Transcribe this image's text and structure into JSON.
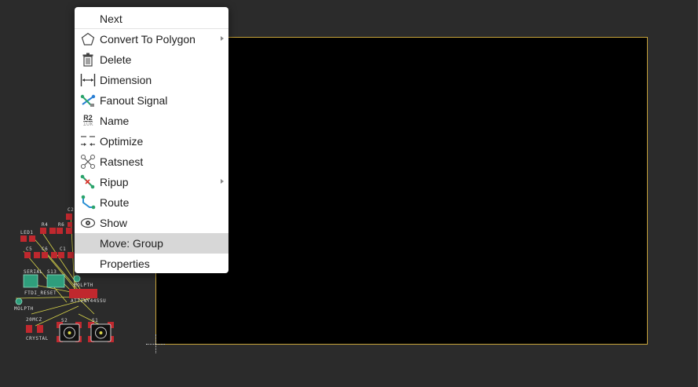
{
  "menu": {
    "items": [
      {
        "label": "Next",
        "icon": "none",
        "submenu": false
      },
      {
        "label": "Convert To Polygon",
        "icon": "polygon-icon",
        "submenu": true
      },
      {
        "label": "Delete",
        "icon": "trash-icon",
        "submenu": false
      },
      {
        "label": "Dimension",
        "icon": "dimension-icon",
        "submenu": false
      },
      {
        "label": "Fanout Signal",
        "icon": "fanout-icon",
        "submenu": false
      },
      {
        "label": "Name",
        "icon": "name-icon",
        "submenu": false
      },
      {
        "label": "Optimize",
        "icon": "optimize-icon",
        "submenu": false
      },
      {
        "label": "Ratsnest",
        "icon": "ratsnest-icon",
        "submenu": false
      },
      {
        "label": "Ripup",
        "icon": "ripup-icon",
        "submenu": true
      },
      {
        "label": "Route",
        "icon": "route-icon",
        "submenu": false
      },
      {
        "label": "Show",
        "icon": "eye-icon",
        "submenu": false
      },
      {
        "label": "Move: Group",
        "icon": "none",
        "submenu": false,
        "highlighted": true
      },
      {
        "label": "Properties",
        "icon": "none",
        "submenu": false
      }
    ],
    "name_icon_text": {
      "top": "R2",
      "bottom": "10k"
    }
  },
  "pcb_labels": {
    "led": "LED1",
    "r4": "R4",
    "r6": "R6",
    "c5": "C5",
    "c6": "C6",
    "c1": "C1",
    "c2": "C2",
    "serial": "SERIAL",
    "s13": "S13",
    "ftdi_reset": "FTDI_RESET",
    "molpth1": "MOLPTH",
    "molpth2": "MOLPTH",
    "attiny": "ATTINY44SSU",
    "mhz": "20MCZ",
    "crystal": "CRYSTAL",
    "s2": "S2",
    "s1": "S1"
  },
  "colors": {
    "background": "#2b2b2b",
    "board": "#000000",
    "board_outline": "#c8a43a",
    "pad": "#c0282e",
    "ratsnest": "#d8d44a",
    "menu_highlight": "#d7d7d7"
  }
}
